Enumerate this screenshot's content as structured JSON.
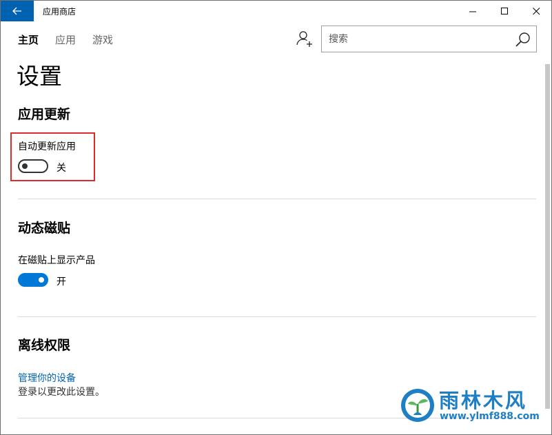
{
  "window": {
    "title": "应用商店",
    "controls": [
      "minimize-icon",
      "maximize-icon",
      "close-icon"
    ]
  },
  "nav": {
    "items": [
      {
        "label": "主页",
        "active": true
      },
      {
        "label": "应用",
        "active": false
      },
      {
        "label": "游戏",
        "active": false
      }
    ]
  },
  "search": {
    "placeholder": "搜索",
    "value": ""
  },
  "page": {
    "title": "设置"
  },
  "sections": [
    {
      "title": "应用更新",
      "setting_label": "自动更新应用",
      "toggle_on": false,
      "toggle_state_label": "关"
    },
    {
      "title": "动态磁贴",
      "setting_label": "在磁贴上显示产品",
      "toggle_on": true,
      "toggle_state_label": "开"
    },
    {
      "title": "离线权限",
      "link_label": "管理你的设备",
      "hint": "登录以更改此设置。"
    }
  ],
  "watermark": {
    "name": "雨林木风",
    "url": "www.ylmf888.com"
  },
  "colors": {
    "accent": "#0063b1",
    "toggle_on": "#0078d7",
    "highlight": "#e0292f",
    "watermark": "#1f7fc4"
  }
}
